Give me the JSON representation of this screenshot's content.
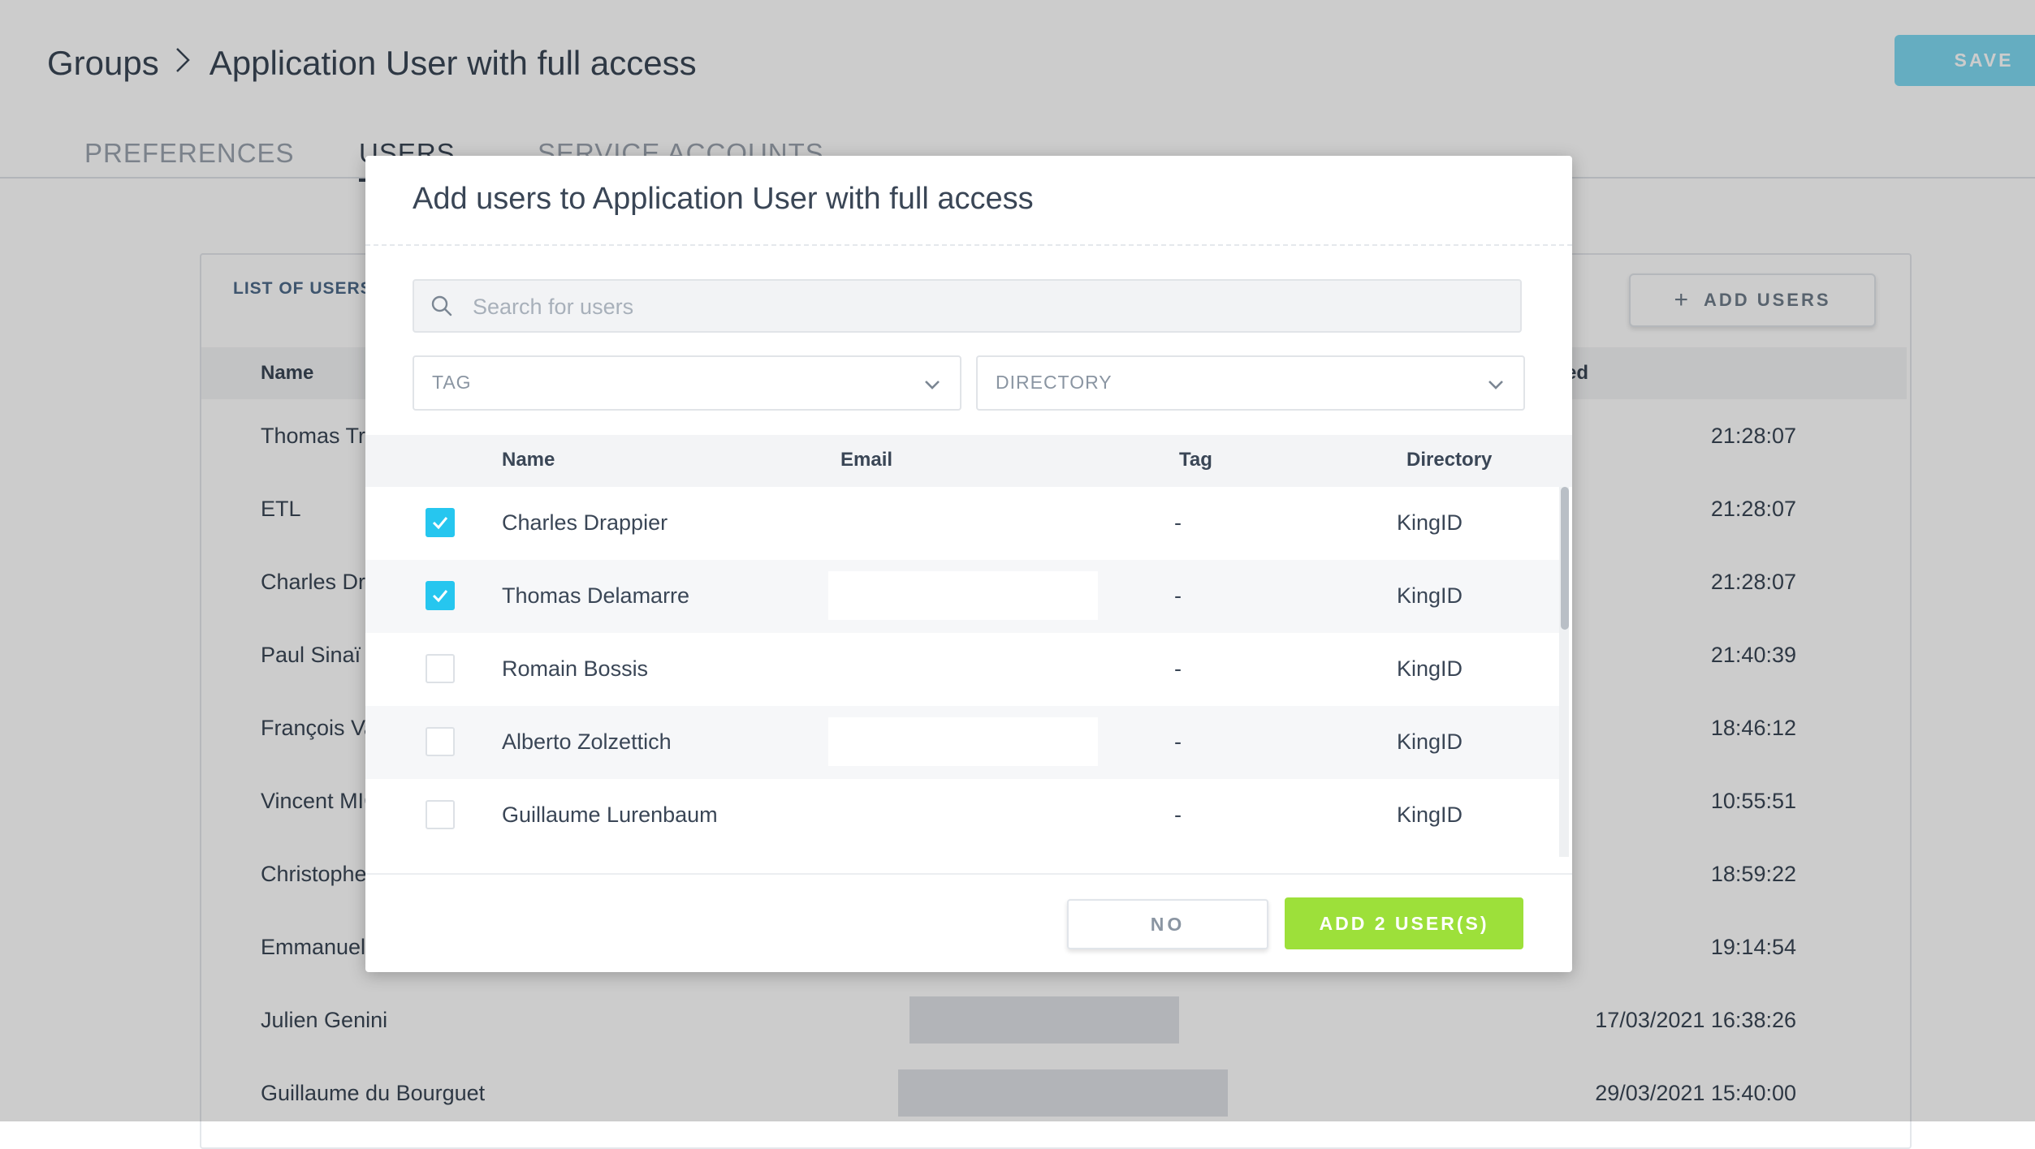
{
  "header": {
    "breadcrumb_root": "Groups",
    "breadcrumb_current": "Application User with full access",
    "save_label": "SAVE"
  },
  "tabs": [
    {
      "label": "PREFERENCES"
    },
    {
      "label": "USERS"
    },
    {
      "label": "SERVICE ACCOUNTS"
    }
  ],
  "users_panel": {
    "title": "LIST OF USERS",
    "add_button_label": "ADD USERS",
    "columns": {
      "name": "Name",
      "date_partial": "ed"
    },
    "rows": [
      {
        "name": "Thomas Tri",
        "date": "21:28:07"
      },
      {
        "name": "ETL",
        "date": "21:28:07"
      },
      {
        "name": "Charles Dra",
        "date": "21:28:07"
      },
      {
        "name": "Paul Sinaï",
        "date": "21:40:39"
      },
      {
        "name": "François Va",
        "date": "18:46:12"
      },
      {
        "name": "Vincent MIC",
        "date": "10:55:51"
      },
      {
        "name": "Christophe",
        "date": "18:59:22"
      },
      {
        "name": "Emmanuel",
        "date": "19:14:54"
      },
      {
        "name": "Julien Genini",
        "date": "17/03/2021 16:38:26"
      },
      {
        "name": "Guillaume du Bourguet",
        "date": "29/03/2021 15:40:00"
      }
    ]
  },
  "modal": {
    "title": "Add users to Application User with full access",
    "search_placeholder": "Search for users",
    "tag_filter": "TAG",
    "directory_filter": "DIRECTORY",
    "columns": {
      "name": "Name",
      "email": "Email",
      "tag": "Tag",
      "directory": "Directory"
    },
    "rows": [
      {
        "name": "Charles Drappier",
        "tag": "-",
        "directory": "KingID",
        "checked": true
      },
      {
        "name": "Thomas Delamarre",
        "tag": "-",
        "directory": "KingID",
        "checked": true
      },
      {
        "name": "Romain Bossis",
        "tag": "-",
        "directory": "KingID",
        "checked": false
      },
      {
        "name": "Alberto Zolzettich",
        "tag": "-",
        "directory": "KingID",
        "checked": false
      },
      {
        "name": "Guillaume Lurenbaum",
        "tag": "-",
        "directory": "KingID",
        "checked": false
      }
    ],
    "no_label": "NO",
    "add_label": "ADD 2 USER(S)"
  },
  "colors": {
    "accent_blue": "#26c6ef",
    "accent_green": "#9de03a",
    "save_blue": "#7fd9f2"
  }
}
